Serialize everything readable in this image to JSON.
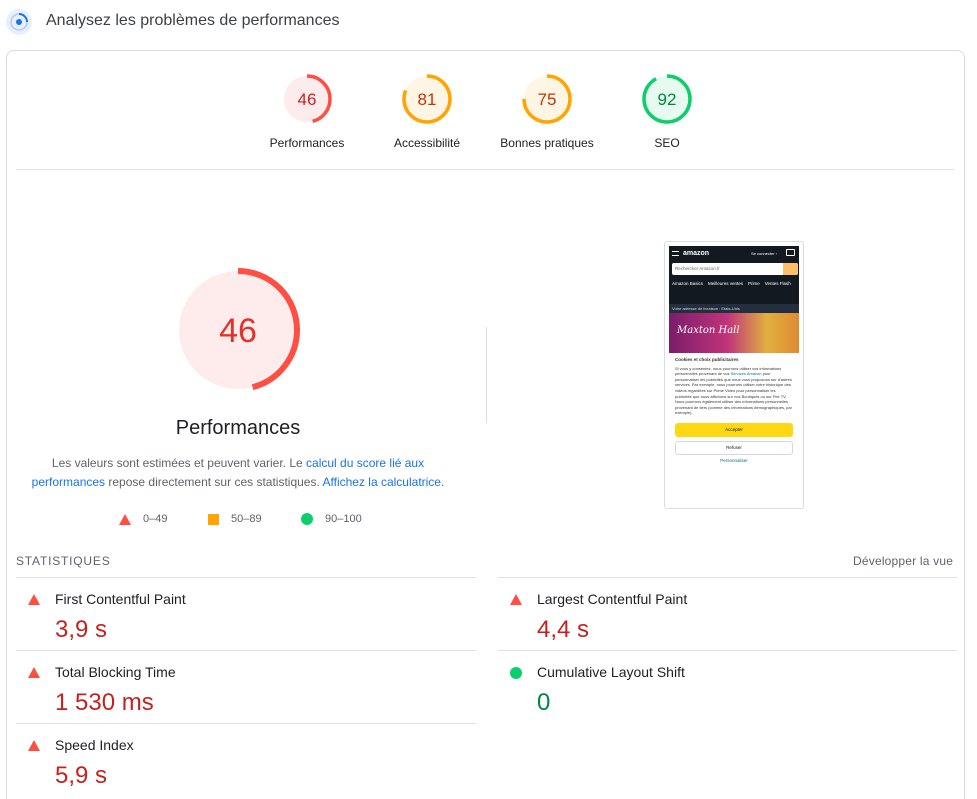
{
  "header": {
    "title": "Analysez les problèmes de performances"
  },
  "colors": {
    "fail": "#ff4e42",
    "average": "#ffa400",
    "pass": "#0cce6b",
    "link": "#1a73e8"
  },
  "categories": [
    {
      "label": "Performances",
      "score": 46,
      "level": "fail"
    },
    {
      "label": "Accessibilité",
      "score": 81,
      "level": "average"
    },
    {
      "label": "Bonnes pratiques",
      "score": 75,
      "level": "average"
    },
    {
      "label": "SEO",
      "score": 92,
      "level": "pass"
    }
  ],
  "main_gauge": {
    "score": 46,
    "title": "Performances",
    "desc_part1": "Les valeurs sont estimées et peuvent varier. Le ",
    "desc_link1": "calcul du score lié aux performances",
    "desc_part2": " repose directement sur ces statistiques. ",
    "desc_link2": "Affichez la calculatrice",
    "desc_part3": "."
  },
  "legend": [
    {
      "shape": "triangle",
      "range": "0–49"
    },
    {
      "shape": "square",
      "range": "50–89"
    },
    {
      "shape": "circle",
      "range": "90–100"
    }
  ],
  "screenshot": {
    "logo": "amazon",
    "login": "Se connecter ›",
    "search_placeholder": "Rechercher Amazon.fr",
    "nav": [
      "Amazon Basics",
      "Meilleures ventes",
      "Prime",
      "Ventes Flash"
    ],
    "location": "Votre adresse de livraison : Etats-Unis",
    "banner": "Maxton Hall",
    "cookie_title": "Cookies et choix publicitaires",
    "cookie_text1": "Si vous y consentez, nous pourrons utiliser vos informations personnelles provenant de vos ",
    "cookie_link": "Services Amazon",
    "cookie_text2": " pour personnaliser les publicités que nous vous proposons sur d'autres services. Par exemple, nous pourrons utiliser votre historique des vidéos regardées sur Prime Video pour personnaliser les publicités que nous affichons sur nos Boutiques ou sur Fire TV. Nous pourrons également utiliser des informations personnelles provenant de tiers (comme des informations démographiques, par exemple).",
    "cookie_text3": "De plus, si vous y consentez, nous utiliserons également des cookies pour compléter votre expérience d'achat dans les boutiques Amazon.",
    "accept": "Accepter",
    "refuse": "Refuser",
    "customize": "Personnaliser"
  },
  "stats": {
    "title": "STATISTIQUES",
    "expand": "Développer la vue",
    "metrics": [
      {
        "name": "First Contentful Paint",
        "value": "3,9 s",
        "level": "fail"
      },
      {
        "name": "Largest Contentful Paint",
        "value": "4,4 s",
        "level": "fail"
      },
      {
        "name": "Total Blocking Time",
        "value": "1 530 ms",
        "level": "fail"
      },
      {
        "name": "Cumulative Layout Shift",
        "value": "0",
        "level": "pass"
      },
      {
        "name": "Speed Index",
        "value": "5,9 s",
        "level": "fail"
      }
    ]
  }
}
